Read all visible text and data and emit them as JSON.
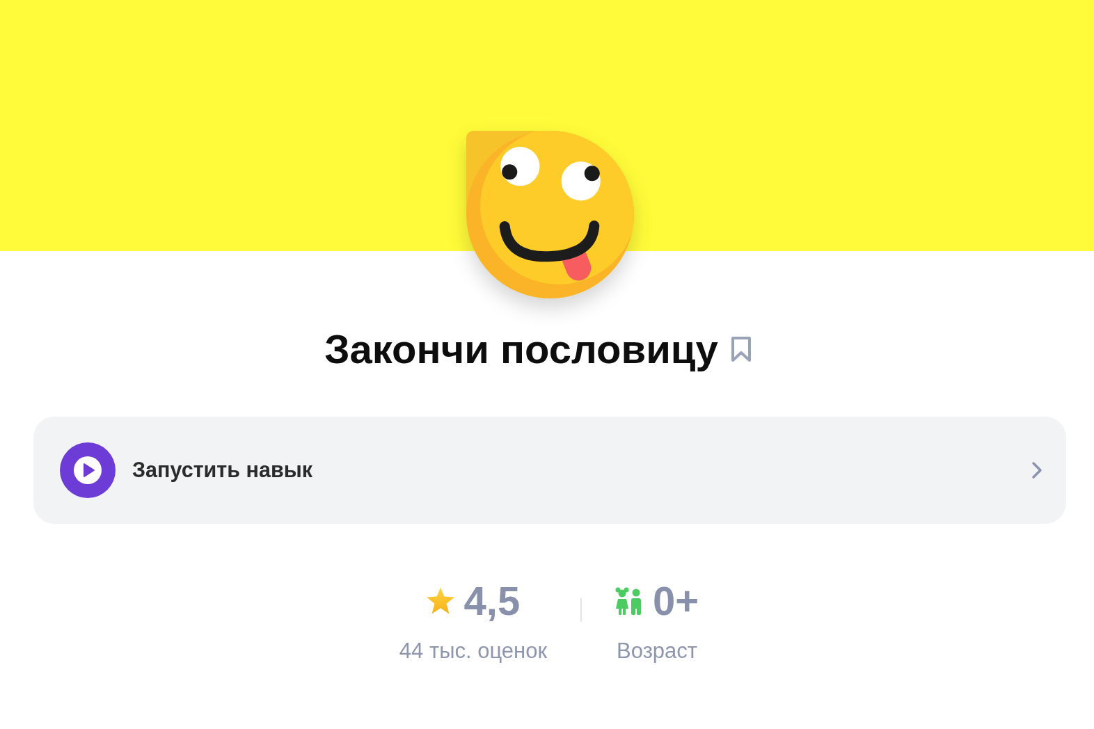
{
  "skill": {
    "title": "Закончи пословицу",
    "bookmarked": false
  },
  "launch_button": {
    "label": "Запустить навык"
  },
  "stats": [
    {
      "kind": "rating",
      "value": "4,5",
      "caption": "44 тыс. оценок"
    },
    {
      "kind": "age",
      "value": "0+",
      "caption": "Возраст"
    }
  ]
}
